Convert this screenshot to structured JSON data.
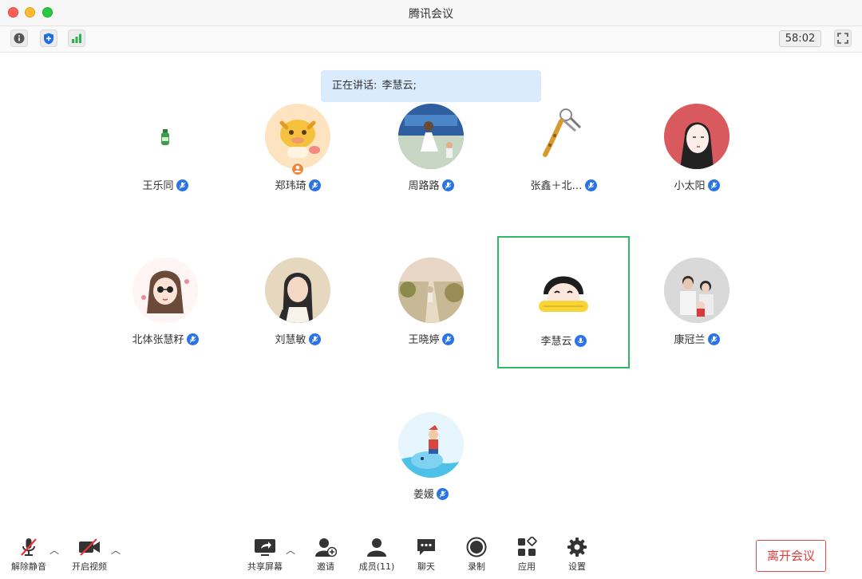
{
  "window": {
    "title": "腾讯会议"
  },
  "toolbar": {
    "timer": "58:02"
  },
  "speaking": {
    "label": "正在讲话:",
    "name": "李慧云;"
  },
  "participants": [
    {
      "name": "王乐同"
    },
    {
      "name": "郑玮琦"
    },
    {
      "name": "周路路"
    },
    {
      "name": "张鑫＋北…"
    },
    {
      "name": "小太阳"
    },
    {
      "name": "北体张慧籽"
    },
    {
      "name": "刘慧敏"
    },
    {
      "name": "王晓婷"
    },
    {
      "name": "李慧云"
    },
    {
      "name": "康冠兰"
    },
    {
      "name": "姜媛"
    }
  ],
  "bottom": {
    "unmute": "解除静音",
    "start_video": "开启视频",
    "share_screen": "共享屏幕",
    "invite": "邀请",
    "members": "成员(11)",
    "chat": "聊天",
    "record": "录制",
    "apps": "应用",
    "settings": "设置",
    "leave": "离开会议"
  },
  "colors": {
    "accent": "#2a74e6",
    "active_border": "#2fb964",
    "leave": "#e03c3c",
    "toast_bg": "#d9ebfd"
  }
}
